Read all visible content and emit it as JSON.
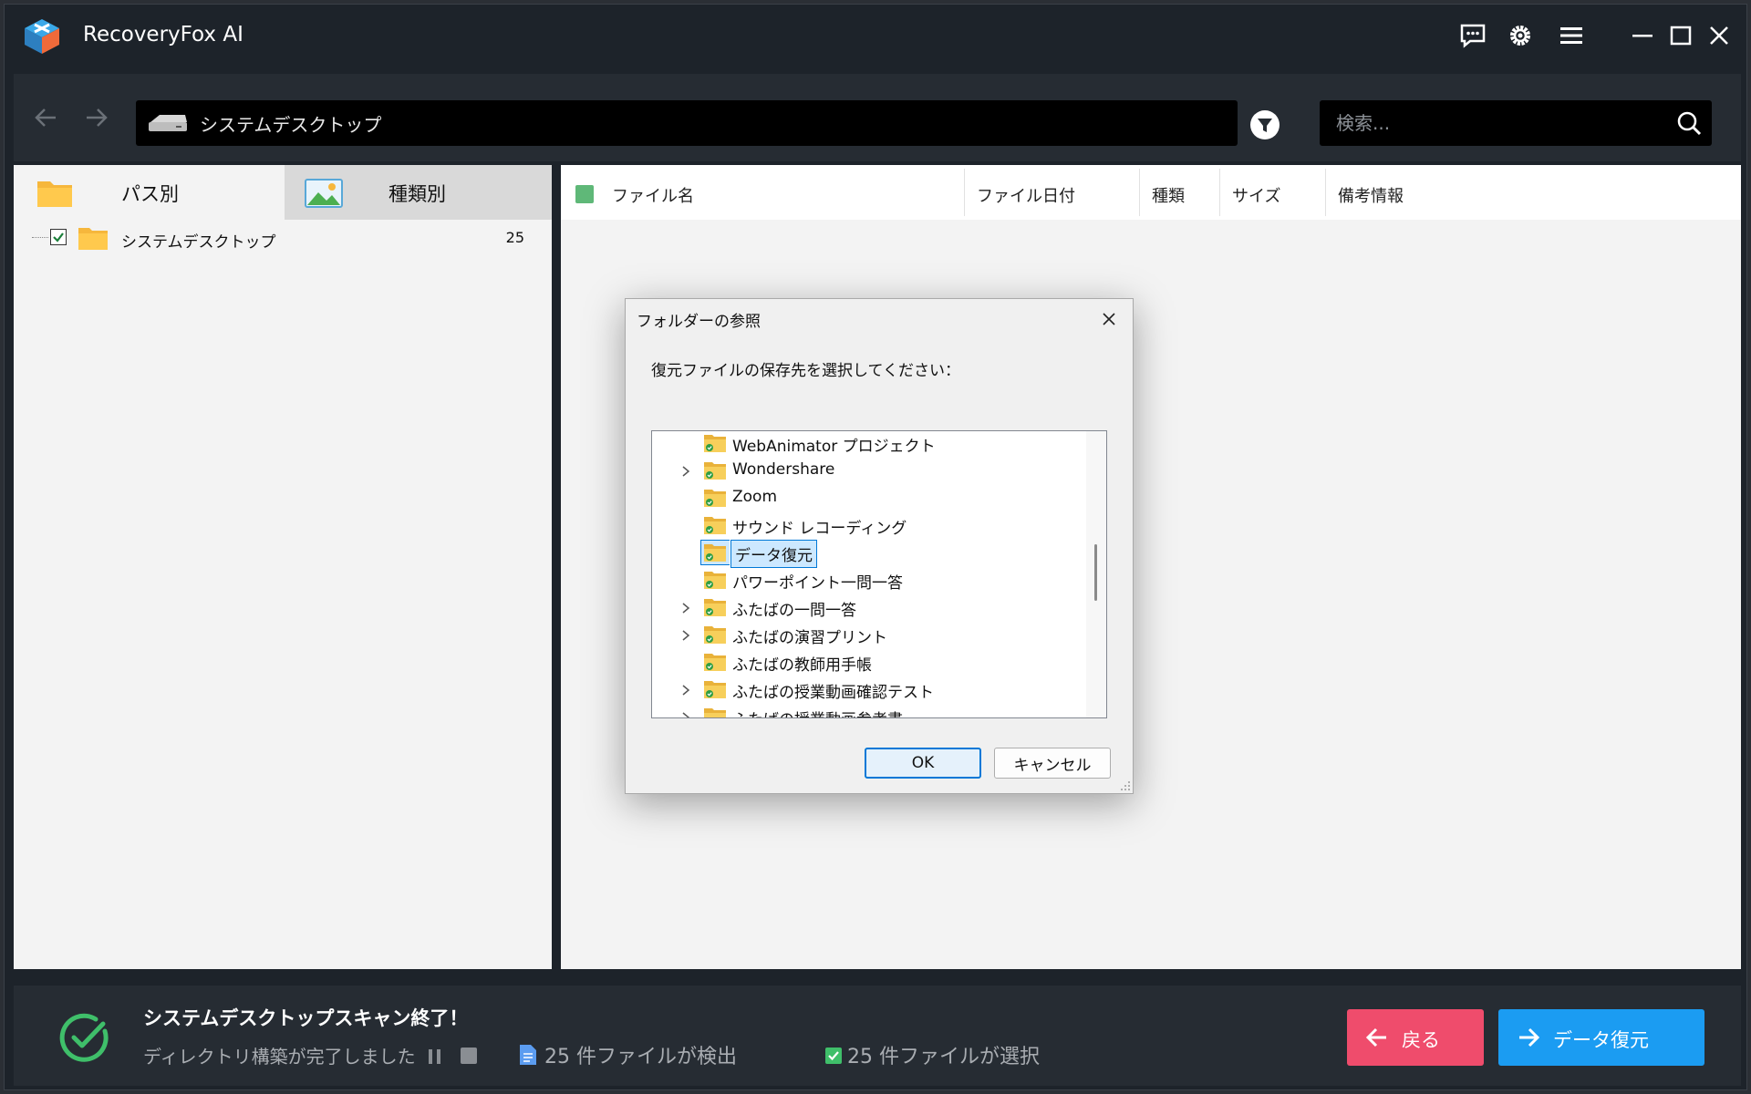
{
  "app": {
    "title": "RecoveryFox AI"
  },
  "toolbar": {
    "path": "システムデスクトップ",
    "search_placeholder": "検索..."
  },
  "left_panel": {
    "tabs": [
      {
        "label": "パス別",
        "active": true
      },
      {
        "label": "種類別",
        "active": false
      }
    ],
    "tree": [
      {
        "label": "システムデスクトップ",
        "count": "25",
        "checked": true
      }
    ]
  },
  "file_list": {
    "columns": [
      "ファイル名",
      "ファイル日付",
      "種類",
      "サイズ",
      "備考情報"
    ]
  },
  "dialog": {
    "title": "フォルダーの参照",
    "prompt": "復元ファイルの保存先を選択してください：",
    "folders": [
      {
        "label": "WebAnimator プロジェクト",
        "expandable": false,
        "selected": false
      },
      {
        "label": "Wondershare",
        "expandable": true,
        "selected": false
      },
      {
        "label": "Zoom",
        "expandable": false,
        "selected": false
      },
      {
        "label": "サウンド レコーディング",
        "expandable": false,
        "selected": false
      },
      {
        "label": "データ復元",
        "expandable": false,
        "selected": true
      },
      {
        "label": "パワーポイント一問一答",
        "expandable": false,
        "selected": false
      },
      {
        "label": "ふたばの一問一答",
        "expandable": true,
        "selected": false
      },
      {
        "label": "ふたばの演習プリント",
        "expandable": true,
        "selected": false
      },
      {
        "label": "ふたばの教師用手帳",
        "expandable": false,
        "selected": false
      },
      {
        "label": "ふたばの授業動画確認テスト",
        "expandable": true,
        "selected": false
      },
      {
        "label": "ふたばの授業動画参考書",
        "expandable": true,
        "selected": false
      }
    ],
    "ok_label": "OK",
    "cancel_label": "キャンセル"
  },
  "status": {
    "title": "システムデスクトップスキャン終了！",
    "subtitle": "ディレクトリ構築が完了しました",
    "found": "25 件ファイルが検出",
    "selected": "25 件ファイルが選択",
    "back_label": "戻る",
    "recover_label": "データ復元"
  },
  "colors": {
    "title_bar": "#1d232a",
    "back_button": "#ef4c6c",
    "recover_button": "#1b9cf2",
    "success": "#3fbf6a",
    "selection": "#cce8ff"
  }
}
